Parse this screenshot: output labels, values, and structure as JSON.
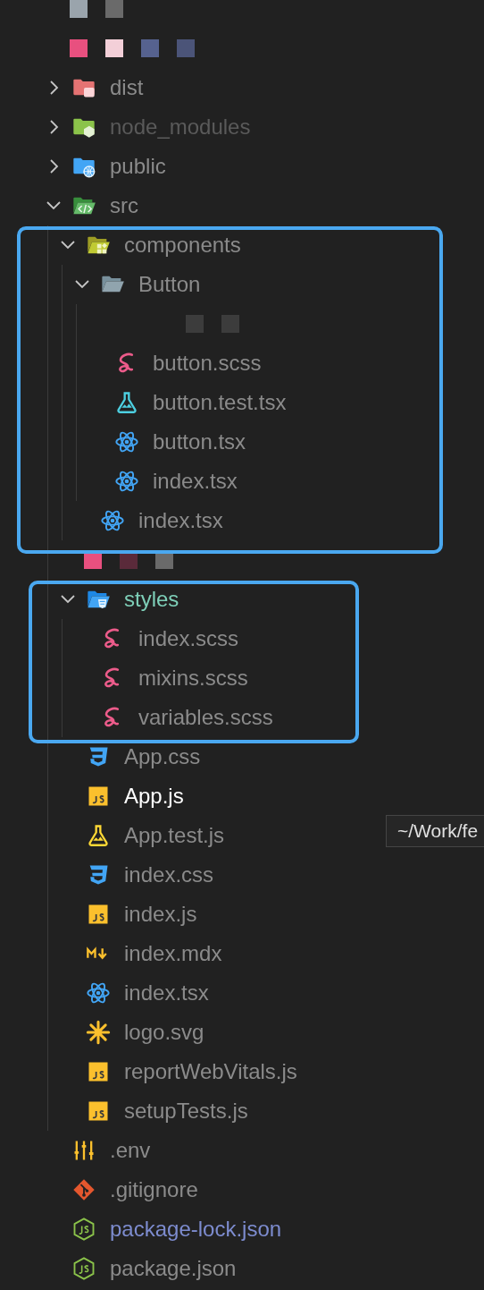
{
  "explorer": {
    "items": [
      {
        "kind": "redacted",
        "blocks": [
          {
            "color": "#9aa4ac"
          },
          {
            "color": "#6a6a6a"
          }
        ]
      },
      {
        "kind": "redacted",
        "blocks": [
          {
            "color": "#e8507f"
          },
          {
            "color": "#f3cfd8"
          },
          {
            "color": "#56628f"
          },
          {
            "color": "#4b5478"
          }
        ]
      },
      {
        "kind": "distfolder",
        "name": "dist",
        "expanded": false,
        "highlighted": false,
        "color": "#8b8b8b"
      },
      {
        "kind": "nodefolder",
        "name": "node_modules",
        "expanded": false,
        "highlighted": false,
        "color": "#5a5a5a"
      },
      {
        "kind": "publicfolder",
        "name": "public",
        "expanded": false,
        "highlighted": false,
        "color": "#8b8b8b"
      },
      {
        "kind": "srcfolder",
        "name": "src",
        "expanded": true,
        "highlighted": false,
        "color": "#8b8b8b",
        "children": [
          {
            "kind": "componentsfolder",
            "name": "components",
            "expanded": true,
            "highlighted": true,
            "color": "#8b8b8b",
            "children": [
              {
                "kind": "plainfolder",
                "name": "Button",
                "expanded": true,
                "highlighted": false,
                "color": "#8b8b8b",
                "children": [
                  {
                    "kind": "redacted",
                    "blocks": [
                      {
                        "color": "#3c3c3c"
                      },
                      {
                        "color": "#3c3c3c"
                      }
                    ]
                  },
                  {
                    "kind": "sass",
                    "name": "button.scss",
                    "color": "#8b8b8b"
                  },
                  {
                    "kind": "tsxtest",
                    "name": "button.test.tsx",
                    "color": "#8b8b8b"
                  },
                  {
                    "kind": "react",
                    "name": "button.tsx",
                    "color": "#8b8b8b"
                  },
                  {
                    "kind": "react",
                    "name": "index.tsx",
                    "color": "#8b8b8b"
                  }
                ]
              },
              {
                "kind": "react",
                "name": "index.tsx",
                "color": "#8b8b8b"
              }
            ]
          },
          {
            "kind": "redacted",
            "blocks": [
              {
                "color": "#e8507f"
              },
              {
                "color": "#5a2a3a"
              },
              {
                "color": "#6a6a6a"
              }
            ]
          },
          {
            "kind": "stylesfolder",
            "name": "styles",
            "expanded": true,
            "highlighted": true,
            "color": "#7ecfb8",
            "children": [
              {
                "kind": "sass",
                "name": "index.scss",
                "color": "#8b8b8b"
              },
              {
                "kind": "sass",
                "name": "mixins.scss",
                "color": "#8b8b8b"
              },
              {
                "kind": "sass",
                "name": "variables.scss",
                "color": "#8b8b8b"
              }
            ]
          },
          {
            "kind": "css",
            "name": "App.css",
            "color": "#8b8b8b"
          },
          {
            "kind": "js",
            "name": "App.js",
            "color": "#ffffff"
          },
          {
            "kind": "jstest",
            "name": "App.test.js",
            "color": "#8b8b8b"
          },
          {
            "kind": "css",
            "name": "index.css",
            "color": "#8b8b8b"
          },
          {
            "kind": "js",
            "name": "index.js",
            "color": "#8b8b8b"
          },
          {
            "kind": "markdown",
            "name": "index.mdx",
            "color": "#8b8b8b"
          },
          {
            "kind": "react",
            "name": "index.tsx",
            "color": "#8b8b8b"
          },
          {
            "kind": "svg",
            "name": "logo.svg",
            "color": "#8b8b8b"
          },
          {
            "kind": "js",
            "name": "reportWebVitals.js",
            "color": "#8b8b8b"
          },
          {
            "kind": "js",
            "name": "setupTests.js",
            "color": "#8b8b8b"
          }
        ]
      },
      {
        "kind": "env",
        "name": ".env",
        "color": "#8b8b8b"
      },
      {
        "kind": "git",
        "name": ".gitignore",
        "color": "#8b8b8b"
      },
      {
        "kind": "nodejs",
        "name": "package-lock.json",
        "color": "#7d8ccf"
      },
      {
        "kind": "nodejs",
        "name": "package.json",
        "color": "#8b8b8b"
      }
    ]
  },
  "tooltip": {
    "text": "~/Work/fe"
  }
}
